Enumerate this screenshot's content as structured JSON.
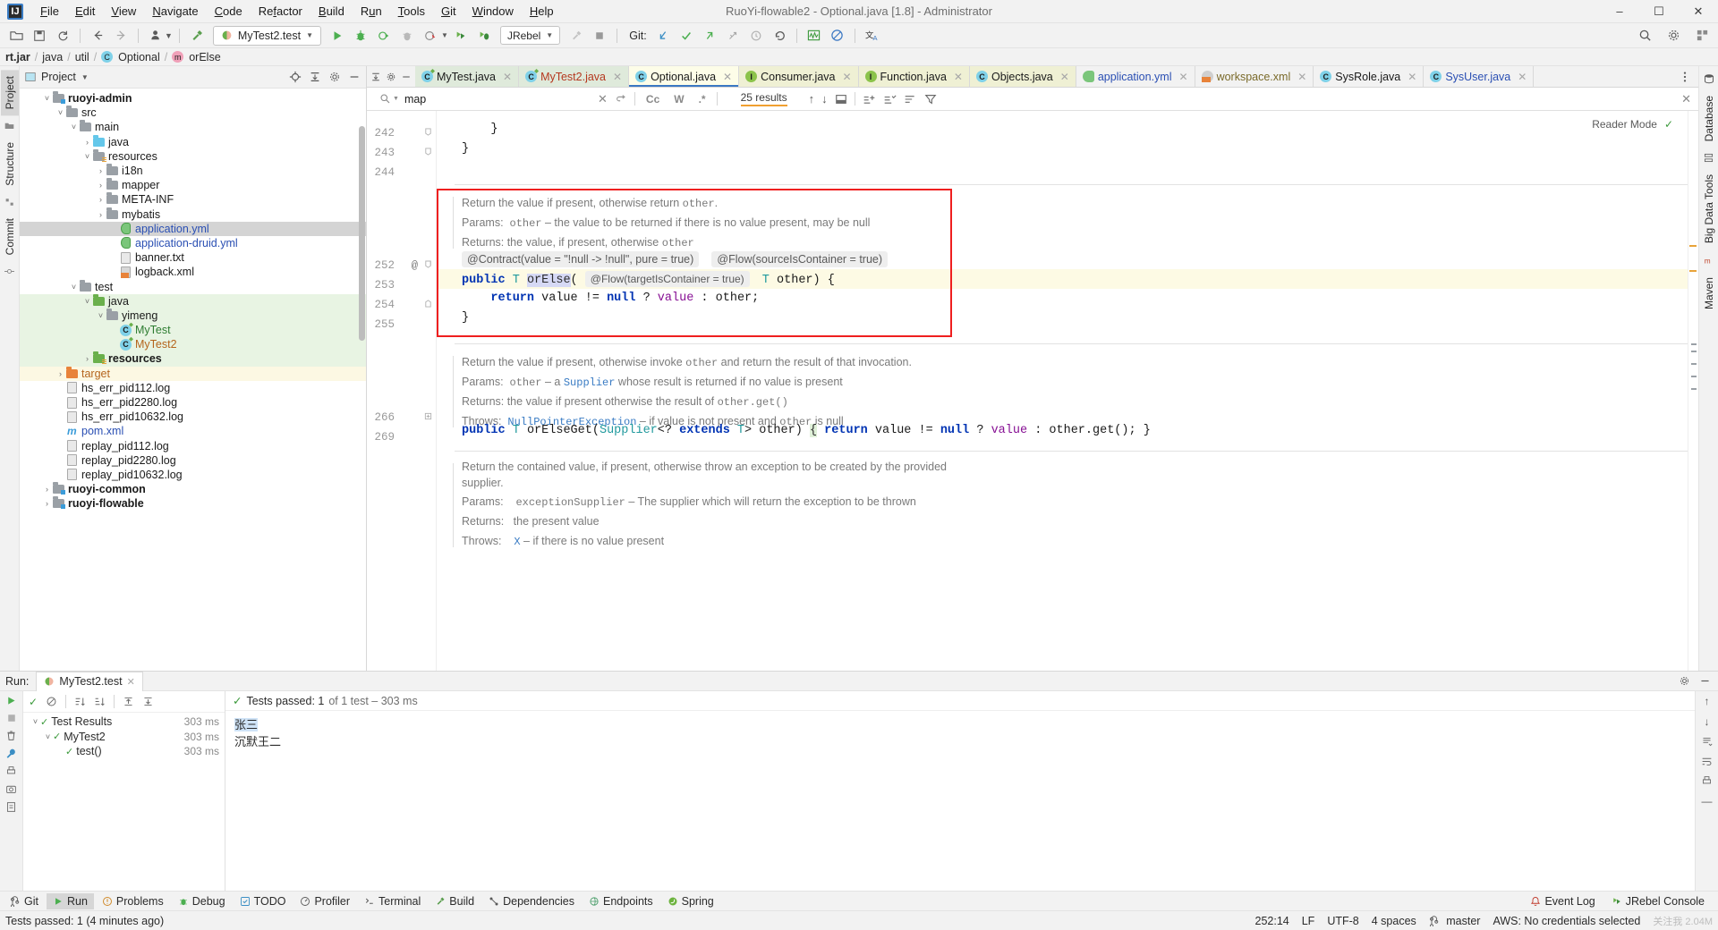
{
  "window": {
    "title": "RuoYi-flowable2 - Optional.java [1.8] - Administrator",
    "minimize": "–",
    "maximize": "☐",
    "close": "✕"
  },
  "menu": [
    "File",
    "Edit",
    "View",
    "Navigate",
    "Code",
    "Refactor",
    "Build",
    "Run",
    "Tools",
    "Git",
    "Window",
    "Help"
  ],
  "toolbar": {
    "run_config": "MyTest2.test",
    "jrebel": "JRebel",
    "git_label": "Git:"
  },
  "breadcrumb": [
    {
      "label": "rt.jar",
      "bold": true
    },
    {
      "label": "java"
    },
    {
      "label": "util"
    },
    {
      "label": "Optional",
      "icon": "class-icon"
    },
    {
      "label": "orElse",
      "icon": "method-icon"
    }
  ],
  "left_strip": {
    "tabs": [
      "Project",
      "Structure",
      "Commit"
    ],
    "active": "Project"
  },
  "right_strip": {
    "tabs": [
      "Database",
      "Big Data Tools",
      "Maven"
    ]
  },
  "project_panel": {
    "title": "Project",
    "tree": [
      {
        "indent": 1,
        "arrow": "down",
        "icon": "module-folder",
        "label": "ruoyi-admin",
        "style": "bold"
      },
      {
        "indent": 2,
        "arrow": "down",
        "icon": "folder",
        "label": "src"
      },
      {
        "indent": 3,
        "arrow": "down",
        "icon": "folder",
        "label": "main"
      },
      {
        "indent": 4,
        "arrow": "right",
        "icon": "folder-blue",
        "label": "java"
      },
      {
        "indent": 4,
        "arrow": "down",
        "icon": "folder-res",
        "label": "resources"
      },
      {
        "indent": 5,
        "arrow": "right",
        "icon": "folder",
        "label": "i18n"
      },
      {
        "indent": 5,
        "arrow": "right",
        "icon": "folder",
        "label": "mapper"
      },
      {
        "indent": 5,
        "arrow": "right",
        "icon": "folder",
        "label": "META-INF"
      },
      {
        "indent": 5,
        "arrow": "right",
        "icon": "folder",
        "label": "mybatis"
      },
      {
        "indent": 6,
        "arrow": "none",
        "icon": "yml-file",
        "label": "application.yml",
        "style": "link",
        "row": "selected"
      },
      {
        "indent": 6,
        "arrow": "none",
        "icon": "yml-file",
        "label": "application-druid.yml",
        "style": "link"
      },
      {
        "indent": 6,
        "arrow": "none",
        "icon": "txt-file",
        "label": "banner.txt"
      },
      {
        "indent": 6,
        "arrow": "none",
        "icon": "xml-file",
        "label": "logback.xml"
      },
      {
        "indent": 3,
        "arrow": "down",
        "icon": "folder",
        "label": "test"
      },
      {
        "indent": 4,
        "arrow": "down",
        "icon": "folder-green",
        "label": "java",
        "row": "green"
      },
      {
        "indent": 5,
        "arrow": "down",
        "icon": "package-folder",
        "label": "yimeng",
        "row": "green"
      },
      {
        "indent": 6,
        "arrow": "none",
        "icon": "test-class-icon",
        "label": "MyTest",
        "style": "green",
        "row": "green"
      },
      {
        "indent": 6,
        "arrow": "none",
        "icon": "test-class-icon",
        "label": "MyTest2",
        "style": "orange",
        "row": "green"
      },
      {
        "indent": 4,
        "arrow": "right",
        "icon": "folder-res-test",
        "label": "resources",
        "style": "bold",
        "row": "green"
      },
      {
        "indent": 2,
        "arrow": "right",
        "icon": "folder-orange",
        "label": "target",
        "style": "orange",
        "row": "yellow"
      },
      {
        "indent": 2,
        "arrow": "none",
        "icon": "log-file",
        "label": "hs_err_pid112.log"
      },
      {
        "indent": 2,
        "arrow": "none",
        "icon": "log-file",
        "label": "hs_err_pid2280.log"
      },
      {
        "indent": 2,
        "arrow": "none",
        "icon": "log-file",
        "label": "hs_err_pid10632.log"
      },
      {
        "indent": 2,
        "arrow": "none",
        "icon": "maven-file",
        "label": "pom.xml",
        "style": "link"
      },
      {
        "indent": 2,
        "arrow": "none",
        "icon": "log-file",
        "label": "replay_pid112.log"
      },
      {
        "indent": 2,
        "arrow": "none",
        "icon": "log-file",
        "label": "replay_pid2280.log"
      },
      {
        "indent": 2,
        "arrow": "none",
        "icon": "log-file",
        "label": "replay_pid10632.log"
      },
      {
        "indent": 1,
        "arrow": "right",
        "icon": "module-folder",
        "label": "ruoyi-common",
        "style": "bold"
      },
      {
        "indent": 1,
        "arrow": "right",
        "icon": "module-folder",
        "label": "ruoyi-flowable",
        "style": "bold"
      }
    ]
  },
  "editor": {
    "tabs": [
      {
        "label": "MyTest.java",
        "icon": "test-class-icon",
        "bg": "green",
        "color": "green"
      },
      {
        "label": "MyTest2.java",
        "icon": "test-class-icon",
        "bg": "green",
        "color": "red"
      },
      {
        "label": "Optional.java",
        "icon": "class-icon",
        "bg": "active",
        "color": "plain"
      },
      {
        "label": "Consumer.java",
        "icon": "interface-icon",
        "bg": "yellow",
        "color": "plain"
      },
      {
        "label": "Function.java",
        "icon": "interface-icon",
        "bg": "yellow",
        "color": "plain"
      },
      {
        "label": "Objects.java",
        "icon": "class-icon",
        "bg": "yellow",
        "color": "plain"
      },
      {
        "label": "application.yml",
        "icon": "yml-file",
        "bg": "plain",
        "color": "blue"
      },
      {
        "label": "workspace.xml",
        "icon": "xml-file",
        "bg": "plain",
        "color": "brown"
      },
      {
        "label": "SysRole.java",
        "icon": "class-icon",
        "bg": "plain",
        "color": "plain"
      },
      {
        "label": "SysUser.java",
        "icon": "class-icon",
        "bg": "plain",
        "color": "blue"
      }
    ],
    "reader_mode": "Reader Mode",
    "search": {
      "value": "map",
      "results": "25 results",
      "case_toggle": "Cc",
      "word_toggle": "W",
      "regex_toggle": ".*"
    },
    "gutter_numbers": [
      "242",
      "243",
      "244",
      "252",
      "253",
      "254",
      "255",
      "266",
      "269"
    ],
    "gutter_annotation": "@",
    "code_lines": [
      {
        "n": "242",
        "text": "}"
      },
      {
        "n": "243",
        "text": "}"
      },
      {
        "n": "244",
        "text": ""
      }
    ],
    "doc_block_1": [
      "Return the value if present, otherwise return other.",
      "Params:  other – the value to be returned if there is no value present, may be null",
      "Returns: the value, if present, otherwise other"
    ],
    "annotations_1": [
      "@Contract(value = \"!null -> !null\", pure = true)",
      "@Flow(sourceIsContainer = true)"
    ],
    "signature_1": {
      "kw_public": "public",
      "type_T": "T",
      "method": "orElse",
      "paren_open": "(",
      "inline_annot": "@Flow(targetIsContainer = true)",
      "param_type": "T",
      "param_name": "other",
      "tail": ") {"
    },
    "body_1": "return value != null ? value : other;",
    "close_1": "}",
    "doc_block_2": [
      "Return the value if present, otherwise invoke other and return the result of that invocation.",
      "Params:  other – a Supplier whose result is returned if no value is present",
      "Returns: the value if present otherwise the result of other.get()",
      "Throws:  NullPointerException – if value is not present and other is null"
    ],
    "signature_2": "public T orElseGet(Supplier<? extends T> other) { return value != null ? value : other.get(); }",
    "doc_block_3": [
      "Return the contained value, if present, otherwise throw an exception to be created by the provided",
      "supplier.",
      "Params:    exceptionSupplier – The supplier which will return the exception to be thrown",
      "Returns:   the present value",
      "Throws:    X – if there is no value present"
    ]
  },
  "run_panel": {
    "label": "Run:",
    "tab": "MyTest2.test",
    "status_text": "Tests passed: 1",
    "status_suffix": "of 1 test – 303 ms",
    "tests": [
      {
        "indent": 0,
        "arrow": "down",
        "label": "Test Results",
        "duration": "303 ms"
      },
      {
        "indent": 1,
        "arrow": "down",
        "label": "MyTest2",
        "duration": "303 ms"
      },
      {
        "indent": 2,
        "arrow": "none",
        "label": "test()",
        "duration": "303 ms"
      }
    ],
    "console": [
      "张三",
      "沉默王二"
    ]
  },
  "bottom_bar": {
    "left": [
      {
        "label": "Git",
        "icon": "git-icon"
      },
      {
        "label": "Run",
        "icon": "run-icon",
        "active": true
      },
      {
        "label": "Problems",
        "icon": "problems-icon"
      },
      {
        "label": "Debug",
        "icon": "debug-icon"
      },
      {
        "label": "TODO",
        "icon": "todo-icon"
      },
      {
        "label": "Profiler",
        "icon": "profiler-icon"
      },
      {
        "label": "Terminal",
        "icon": "terminal-icon"
      },
      {
        "label": "Build",
        "icon": "build-icon"
      },
      {
        "label": "Dependencies",
        "icon": "dependencies-icon"
      },
      {
        "label": "Endpoints",
        "icon": "endpoints-icon"
      },
      {
        "label": "Spring",
        "icon": "spring-icon"
      }
    ],
    "right": [
      {
        "label": "Event Log",
        "icon": "event-log-icon"
      },
      {
        "label": "JRebel Console",
        "icon": "jrebel-icon"
      }
    ]
  },
  "status_bar": {
    "message": "Tests passed: 1 (4 minutes ago)",
    "right": [
      "252:14",
      "LF",
      "UTF-8",
      "4 spaces",
      "master",
      "AWS: No credentials selected"
    ],
    "watermark": "关注我 2.04M"
  },
  "colors": {
    "accent_blue": "#3b78c3",
    "highlight_red": "#ef1f1f",
    "selection": "#d6d9f5",
    "pass_green": "#3c9a3c",
    "current_line": "#fdfae4"
  }
}
